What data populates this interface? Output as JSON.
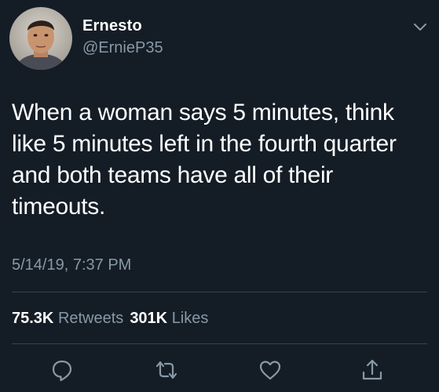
{
  "author": {
    "display_name": "Ernesto",
    "handle": "@ErnieP35"
  },
  "tweet": {
    "lines": [
      "When a woman says 5 minutes, think",
      "like 5 minutes left in the fourth quarter",
      "and both teams have all of their",
      "timeouts."
    ],
    "timestamp": "5/14/19, 7:37 PM"
  },
  "stats": {
    "retweets_count": "75.3K",
    "retweets_label": "Retweets",
    "likes_count": "301K",
    "likes_label": "Likes"
  },
  "icons": {
    "menu": "chevron-down-icon",
    "reply": "reply-icon",
    "retweet": "retweet-icon",
    "like": "heart-icon",
    "share": "share-icon"
  },
  "colors": {
    "background": "#141d26",
    "primary_text": "#ffffff",
    "secondary_text": "#8899a6",
    "divider": "#38444d"
  }
}
